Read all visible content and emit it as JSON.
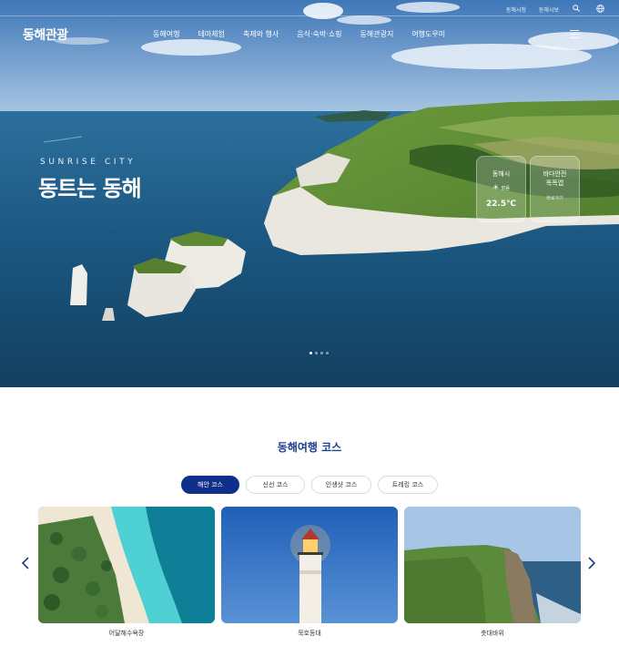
{
  "header": {
    "logo": "동해관광",
    "util_links": [
      "동해시청",
      "동해시보"
    ],
    "util_icons": [
      "search-icon",
      "globe-icon"
    ],
    "menu": [
      "동해여행",
      "테마체험",
      "축제와 행사",
      "음식·숙박·쇼핑",
      "동해관광지",
      "여행도우미"
    ]
  },
  "hero": {
    "tagline_en": "SUNRISE CITY",
    "tagline_ko": "동트는 동해",
    "weather": {
      "city": "동해시",
      "condition": "맑음",
      "temp": "22.5℃"
    },
    "sea_safety": {
      "title_line1": "바다안전",
      "title_line2": "똑똑앱",
      "sub": "바로가기"
    },
    "slide_count": 4,
    "active_slide": 1
  },
  "courses": {
    "title": "동해여행 코스",
    "tabs": [
      "해안 코스",
      "신선 코스",
      "인생샷 코스",
      "트레킹 코스"
    ],
    "active_tab": 0,
    "cards": [
      {
        "caption": "어달해수욕장"
      },
      {
        "caption": "묵호등대"
      },
      {
        "caption": "촛대바위"
      }
    ]
  },
  "colors": {
    "brand_navy": "#0f2f8a",
    "title_blue": "#1c3f8f"
  }
}
